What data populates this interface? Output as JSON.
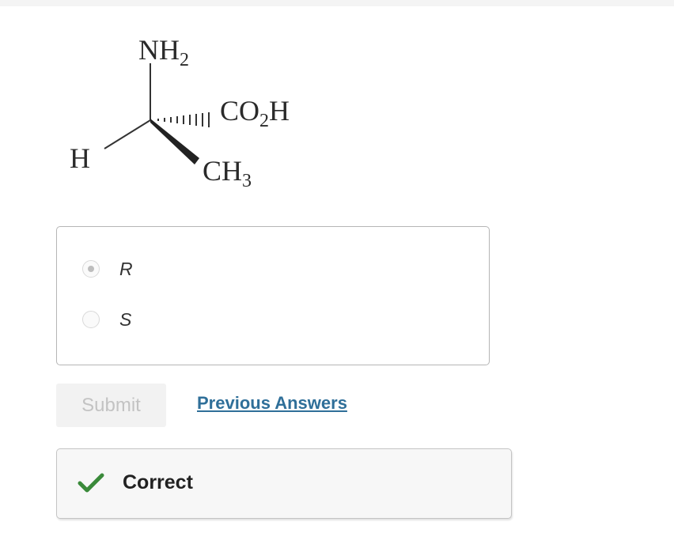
{
  "molecule": {
    "top_group": "NH",
    "top_sub": "2",
    "right_group_a": "CO",
    "right_sub": "2",
    "right_group_b": "H",
    "left_group": "H",
    "bottom_group": "CH",
    "bottom_sub": "3"
  },
  "question": {
    "options": [
      {
        "label": "R",
        "selected": true
      },
      {
        "label": "S",
        "selected": false
      }
    ]
  },
  "actions": {
    "submit_label": "Submit",
    "previous_answers_label": "Previous Answers"
  },
  "feedback": {
    "text": "Correct",
    "icon": "checkmark-icon",
    "icon_color": "#3a8a3a"
  },
  "colors": {
    "link": "#2f6f99",
    "submit_disabled_text": "#c3c3c3",
    "submit_disabled_bg": "#f2f2f2"
  }
}
